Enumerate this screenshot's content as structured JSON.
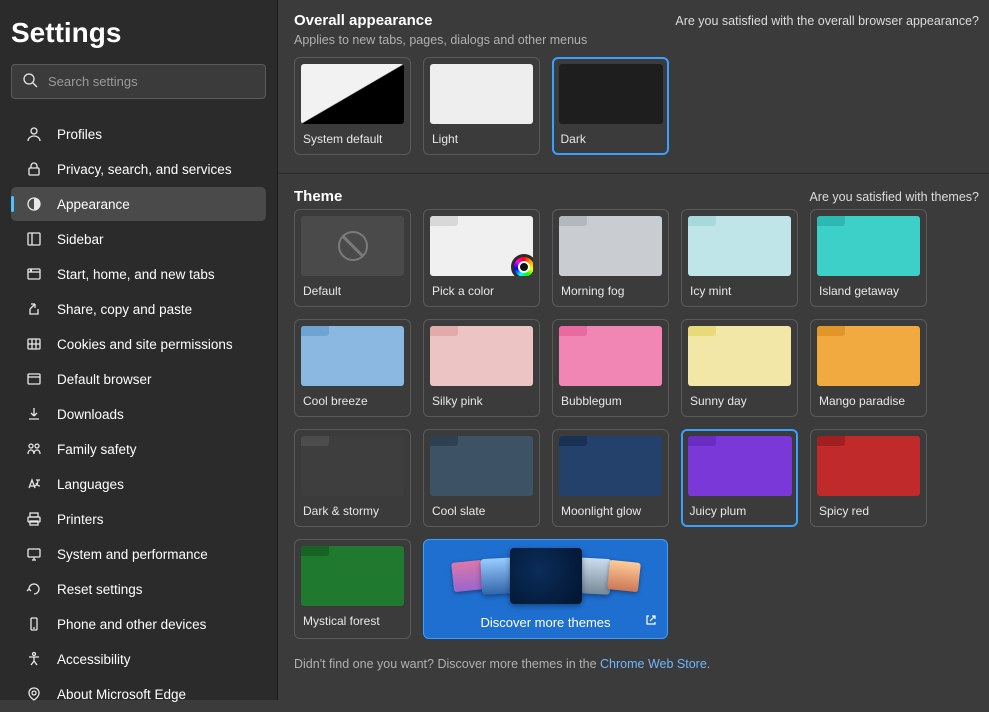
{
  "sidebar": {
    "title": "Settings",
    "searchPlaceholder": "Search settings",
    "items": [
      {
        "label": "Profiles",
        "icon": "profile-icon"
      },
      {
        "label": "Privacy, search, and services",
        "icon": "lock-icon"
      },
      {
        "label": "Appearance",
        "icon": "appearance-icon",
        "active": true
      },
      {
        "label": "Sidebar",
        "icon": "sidebar-icon"
      },
      {
        "label": "Start, home, and new tabs",
        "icon": "start-icon"
      },
      {
        "label": "Share, copy and paste",
        "icon": "share-icon"
      },
      {
        "label": "Cookies and site permissions",
        "icon": "cookie-icon"
      },
      {
        "label": "Default browser",
        "icon": "browser-icon"
      },
      {
        "label": "Downloads",
        "icon": "download-icon"
      },
      {
        "label": "Family safety",
        "icon": "family-icon"
      },
      {
        "label": "Languages",
        "icon": "language-icon"
      },
      {
        "label": "Printers",
        "icon": "printer-icon"
      },
      {
        "label": "System and performance",
        "icon": "system-icon"
      },
      {
        "label": "Reset settings",
        "icon": "reset-icon"
      },
      {
        "label": "Phone and other devices",
        "icon": "phone-icon"
      },
      {
        "label": "Accessibility",
        "icon": "accessibility-icon"
      },
      {
        "label": "About Microsoft Edge",
        "icon": "about-icon"
      }
    ]
  },
  "overall": {
    "title": "Overall appearance",
    "satisfied": "Are you satisfied with the overall browser appearance?",
    "subtitle": "Applies to new tabs, pages, dialogs and other menus",
    "options": [
      {
        "label": "System default",
        "key": "sysdefault"
      },
      {
        "label": "Light",
        "key": "light"
      },
      {
        "label": "Dark",
        "key": "dark",
        "selected": true
      }
    ]
  },
  "theme": {
    "title": "Theme",
    "satisfied": "Are you satisfied with themes?",
    "options": [
      {
        "label": "Default",
        "key": "default-th"
      },
      {
        "label": "Pick a color",
        "key": "pick"
      },
      {
        "label": "Morning fog",
        "key": "morning"
      },
      {
        "label": "Icy mint",
        "key": "icy"
      },
      {
        "label": "Island getaway",
        "key": "island"
      },
      {
        "label": "Cool breeze",
        "key": "breeze"
      },
      {
        "label": "Silky pink",
        "key": "silky"
      },
      {
        "label": "Bubblegum",
        "key": "bubble"
      },
      {
        "label": "Sunny day",
        "key": "sunny"
      },
      {
        "label": "Mango paradise",
        "key": "mango"
      },
      {
        "label": "Dark & stormy",
        "key": "stormy"
      },
      {
        "label": "Cool slate",
        "key": "slate"
      },
      {
        "label": "Moonlight glow",
        "key": "moon"
      },
      {
        "label": "Juicy plum",
        "key": "plum",
        "selected": true
      },
      {
        "label": "Spicy red",
        "key": "spicy"
      },
      {
        "label": "Mystical forest",
        "key": "forest"
      }
    ],
    "discover": "Discover more themes",
    "footnotePrefix": "Didn't find one you want? Discover more themes in the ",
    "footnoteLink": "Chrome Web Store",
    "footnoteSuffix": "."
  }
}
